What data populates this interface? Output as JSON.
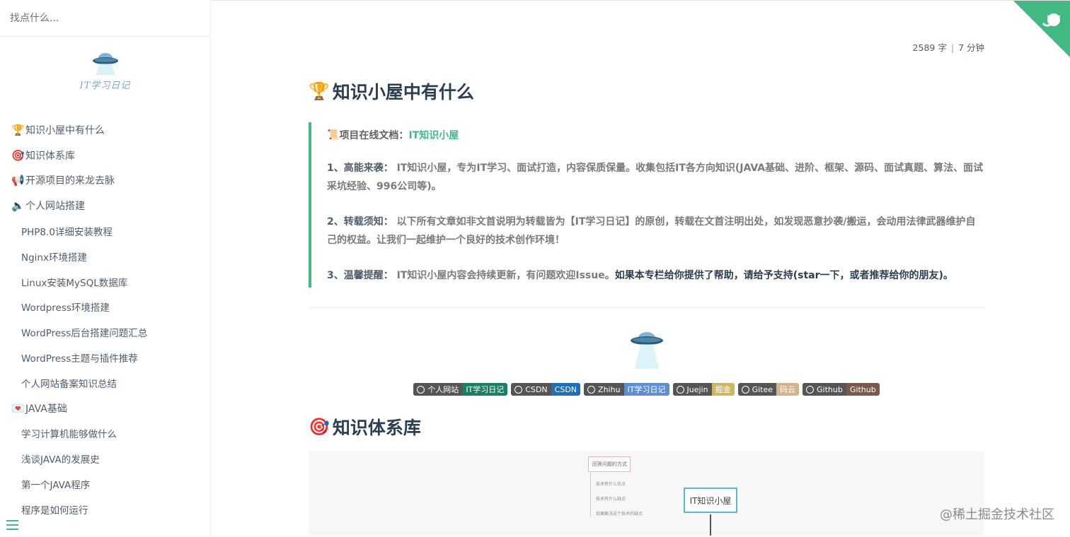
{
  "search": {
    "placeholder": "找点什么..."
  },
  "logo": {
    "text": "IT学习日记"
  },
  "sidebar": {
    "items": [
      {
        "emoji": "🏆",
        "label": "知识小屋中有什么",
        "level": 1
      },
      {
        "emoji": "🎯",
        "label": "知识体系库",
        "level": 1
      },
      {
        "emoji": "📢",
        "label": "开源项目的来龙去脉",
        "level": 1
      },
      {
        "emoji": "🔈",
        "label": "个人网站搭建",
        "level": 1
      },
      {
        "emoji": "",
        "label": "PHP8.0详细安装教程",
        "level": 2
      },
      {
        "emoji": "",
        "label": "Nginx环境搭建",
        "level": 2
      },
      {
        "emoji": "",
        "label": "Linux安装MySQL数据库",
        "level": 2
      },
      {
        "emoji": "",
        "label": "Wordpress环境搭建",
        "level": 2
      },
      {
        "emoji": "",
        "label": "WordPress后台搭建问题汇总",
        "level": 2
      },
      {
        "emoji": "",
        "label": "WordPress主题与插件推荐",
        "level": 2
      },
      {
        "emoji": "",
        "label": "个人网站备案知识总结",
        "level": 2
      },
      {
        "emoji": "💌",
        "label": "JAVA基础",
        "level": 1
      },
      {
        "emoji": "",
        "label": "学习计算机能够做什么",
        "level": 2
      },
      {
        "emoji": "",
        "label": "浅谈JAVA的发展史",
        "level": 2
      },
      {
        "emoji": "",
        "label": "第一个JAVA程序",
        "level": 2
      },
      {
        "emoji": "",
        "label": "程序是如何运行",
        "level": 2
      }
    ]
  },
  "meta": {
    "words": "2589 字",
    "sep": "|",
    "time": "7 分钟"
  },
  "section1": {
    "emoji": "🏆",
    "title": "知识小屋中有什么"
  },
  "quote": {
    "icon": "📜",
    "title_prefix": "项目在线文档：",
    "title_link": "IT知识小屋",
    "p1_label": "1、高能来袭：",
    "p1_text": " IT知识小屋，专为IT学习、面试打造，内容保质保量。收集包括IT各方向知识(JAVA基础、进阶、框架、源码、面试真题、算法、面试采坑经验、996公司等)。",
    "p2_label": "2、转载须知：",
    "p2_text": " 以下所有文章如非文首说明为转载皆为【IT学习日记】的原创，转载在文首注明出处，如发现恶意抄袭/搬运，会动用法律武器维护自己的权益。让我们一起维护一个良好的技术创作环境！",
    "p3_label": "3、温馨提醒：",
    "p3_text": " IT知识小屋内容会持续更新，有问题欢迎Issue。",
    "p3_strong": "如果本专栏给你提供了帮助，请给予支持(star一下，或者推荐给你的朋友)。"
  },
  "badges": [
    {
      "left": "个人网站",
      "right": "IT学习日记",
      "color": "#1a7f64",
      "icon": "cc-icon"
    },
    {
      "left": "CSDN",
      "right": "CSDN",
      "color": "#1f6fb2",
      "icon": "csdn-icon"
    },
    {
      "left": "Zhihu",
      "right": "IT学习日记",
      "color": "#5b8fcf",
      "icon": "zhihu-icon"
    },
    {
      "left": "Juejin",
      "right": "掘金",
      "color": "#c9b766",
      "icon": "juejin-icon"
    },
    {
      "left": "Gitee",
      "right": "码云",
      "color": "#d2b48c",
      "icon": "gitee-icon"
    },
    {
      "left": "Github",
      "right": "Github",
      "color": "#7a5a4a",
      "icon": "github-icon"
    }
  ],
  "section2": {
    "emoji": "🎯",
    "title": "知识体系库"
  },
  "mindmap": {
    "box_label": "回答问题的方式",
    "nodes": [
      "技术有什么优点",
      "技术有什么缺点",
      "如果解决这个技术的缺点"
    ],
    "root": "IT知识小屋"
  },
  "watermark": "@稀土掘金技术社区",
  "colors": {
    "accent": "#42b983",
    "heading": "#2c3e50"
  }
}
